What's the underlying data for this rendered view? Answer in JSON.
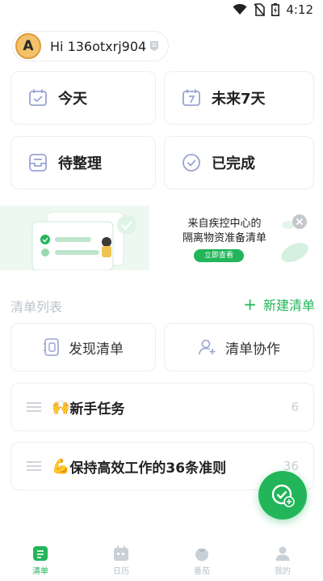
{
  "status": {
    "time": "4:12"
  },
  "profile": {
    "greeting": "Hi 136otxrj904",
    "avatar_letter": "A"
  },
  "quick": [
    {
      "label": "今天",
      "icon": "today-calendar-icon"
    },
    {
      "label": "未来7天",
      "icon": "next7days-calendar-icon"
    },
    {
      "label": "待整理",
      "icon": "inbox-tray-icon"
    },
    {
      "label": "已完成",
      "icon": "check-circle-icon"
    }
  ],
  "banner": {
    "title": "来自疾控中心的\n隔离物资准备清单",
    "button": "立即查看"
  },
  "section": {
    "title": "清单列表",
    "new_label": "新建清单"
  },
  "actions": {
    "discover": "发现清单",
    "collab": "清单协作"
  },
  "lists": [
    {
      "emoji": "🙌",
      "name": "新手任务",
      "count": "6"
    },
    {
      "emoji": "💪",
      "name": "保持高效工作的36条准则",
      "count": "36"
    }
  ],
  "tabs": [
    {
      "label": "清单",
      "icon": "list-icon",
      "active": true
    },
    {
      "label": "日历",
      "icon": "calendar-icon",
      "active": false
    },
    {
      "label": "番茄",
      "icon": "tomato-icon",
      "active": false
    },
    {
      "label": "我的",
      "icon": "profile-icon",
      "active": false
    }
  ],
  "colors": {
    "accent": "#22b55a",
    "muted": "#bcc3cc",
    "icon": "#9aa3d4"
  }
}
